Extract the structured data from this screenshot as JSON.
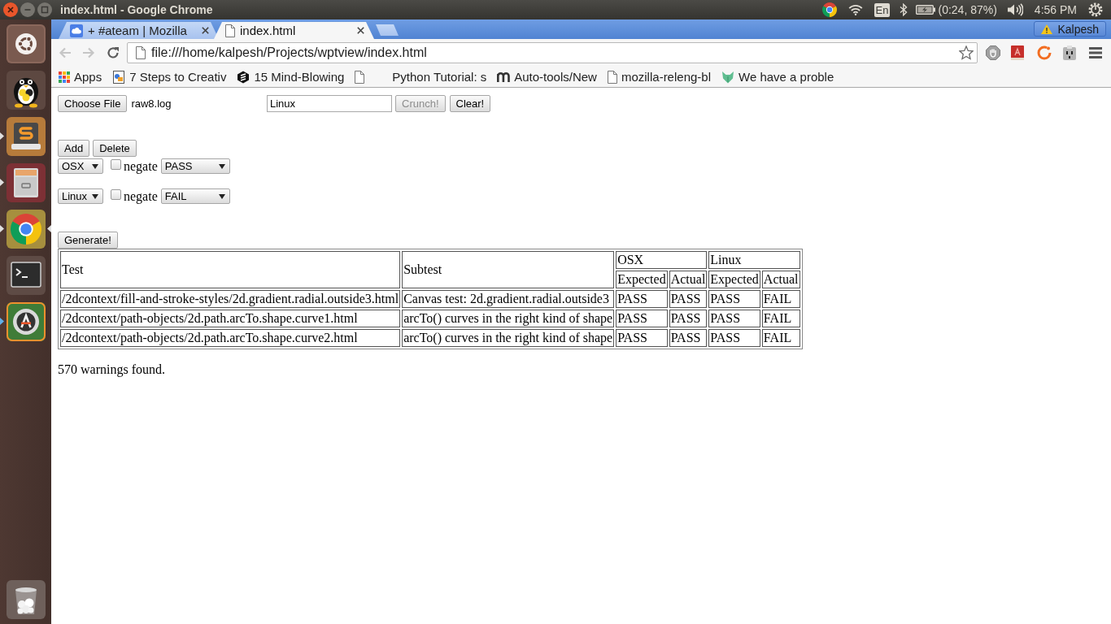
{
  "top_panel": {
    "window_title": "index.html - Google Chrome",
    "keyboard_layout": "En",
    "battery": "(0:24, 87%)",
    "clock": "4:56 PM"
  },
  "launcher": {
    "items": [
      {
        "kind": "dash",
        "running": false,
        "focused": false,
        "urgent": false
      },
      {
        "kind": "penguin",
        "running": false,
        "focused": false,
        "urgent": false
      },
      {
        "kind": "editor",
        "running": true,
        "focused": false,
        "urgent": false
      },
      {
        "kind": "files",
        "running": true,
        "focused": false,
        "urgent": false
      },
      {
        "kind": "browser",
        "running": true,
        "focused": true,
        "urgent": false
      },
      {
        "kind": "terminal",
        "running": false,
        "focused": false,
        "urgent": false
      },
      {
        "kind": "updater",
        "running": true,
        "focused": false,
        "urgent": true
      },
      {
        "kind": "trash",
        "running": false,
        "focused": false,
        "urgent": false
      }
    ]
  },
  "browser": {
    "tabs": [
      {
        "kind": "chat",
        "title": "+ #ateam | Mozilla",
        "selected": false
      },
      {
        "kind": "page",
        "title": "index.html",
        "selected": true
      }
    ],
    "profile": "Kalpesh",
    "nav_buttons": [
      {
        "kind": "back",
        "disabled": true
      },
      {
        "kind": "forward",
        "disabled": true
      },
      {
        "kind": "reload",
        "disabled": false
      }
    ],
    "address": "file:///home/kalpesh/Projects/wptview/index.html",
    "bookmarks": [
      {
        "kind": "apps",
        "label": "Apps"
      },
      {
        "kind": "image",
        "label": "7 Steps to Creativ"
      },
      {
        "kind": "hexagon",
        "label": "15 Mind-Blowing"
      },
      {
        "kind": "page"
      },
      {
        "kind": "blank",
        "label": "Python Tutorial: s"
      },
      {
        "kind": "arches",
        "label": "Auto-tools/New"
      },
      {
        "kind": "page",
        "label": "mozilla-releng-bl"
      },
      {
        "kind": "animal",
        "label": "We have a proble"
      }
    ]
  },
  "page": {
    "file_input": {
      "button": "Choose File",
      "file_name": "raw8.log"
    },
    "filter_field": {
      "value": "Linux"
    },
    "actions": [
      {
        "label": "Crunch!",
        "disabled": true
      },
      {
        "label": "Clear!",
        "disabled": false
      }
    ],
    "rule_buttons": [
      "Add",
      "Delete"
    ],
    "rules": [
      {
        "platform": "OSX",
        "negate": {
          "label": "negate",
          "checked": false
        },
        "status": "PASS"
      },
      {
        "platform": "Linux",
        "negate": {
          "label": "negate",
          "checked": false
        },
        "status": "FAIL"
      }
    ],
    "generate_button": "Generate!",
    "results_table": {
      "columns": [
        "Test",
        "Subtest"
      ],
      "platform_groups": [
        {
          "name": "OSX",
          "columns": [
            "Expected",
            "Actual"
          ]
        },
        {
          "name": "Linux",
          "columns": [
            "Expected",
            "Actual"
          ]
        }
      ],
      "rows": [
        {
          "test": "/2dcontext/fill-and-stroke-styles/2d.gradient.radial.outside3.html",
          "subtest": "Canvas test: 2d.gradient.radial.outside3",
          "results": [
            "PASS",
            "PASS",
            "PASS",
            "FAIL"
          ]
        },
        {
          "test": "/2dcontext/path-objects/2d.path.arcTo.shape.curve1.html",
          "subtest": "arcTo() curves in the right kind of shape",
          "results": [
            "PASS",
            "PASS",
            "PASS",
            "FAIL"
          ]
        },
        {
          "test": "/2dcontext/path-objects/2d.path.arcTo.shape.curve2.html",
          "subtest": "arcTo() curves in the right kind of shape",
          "results": [
            "PASS",
            "PASS",
            "PASS",
            "FAIL"
          ]
        }
      ]
    },
    "summary": "570 warnings found."
  }
}
